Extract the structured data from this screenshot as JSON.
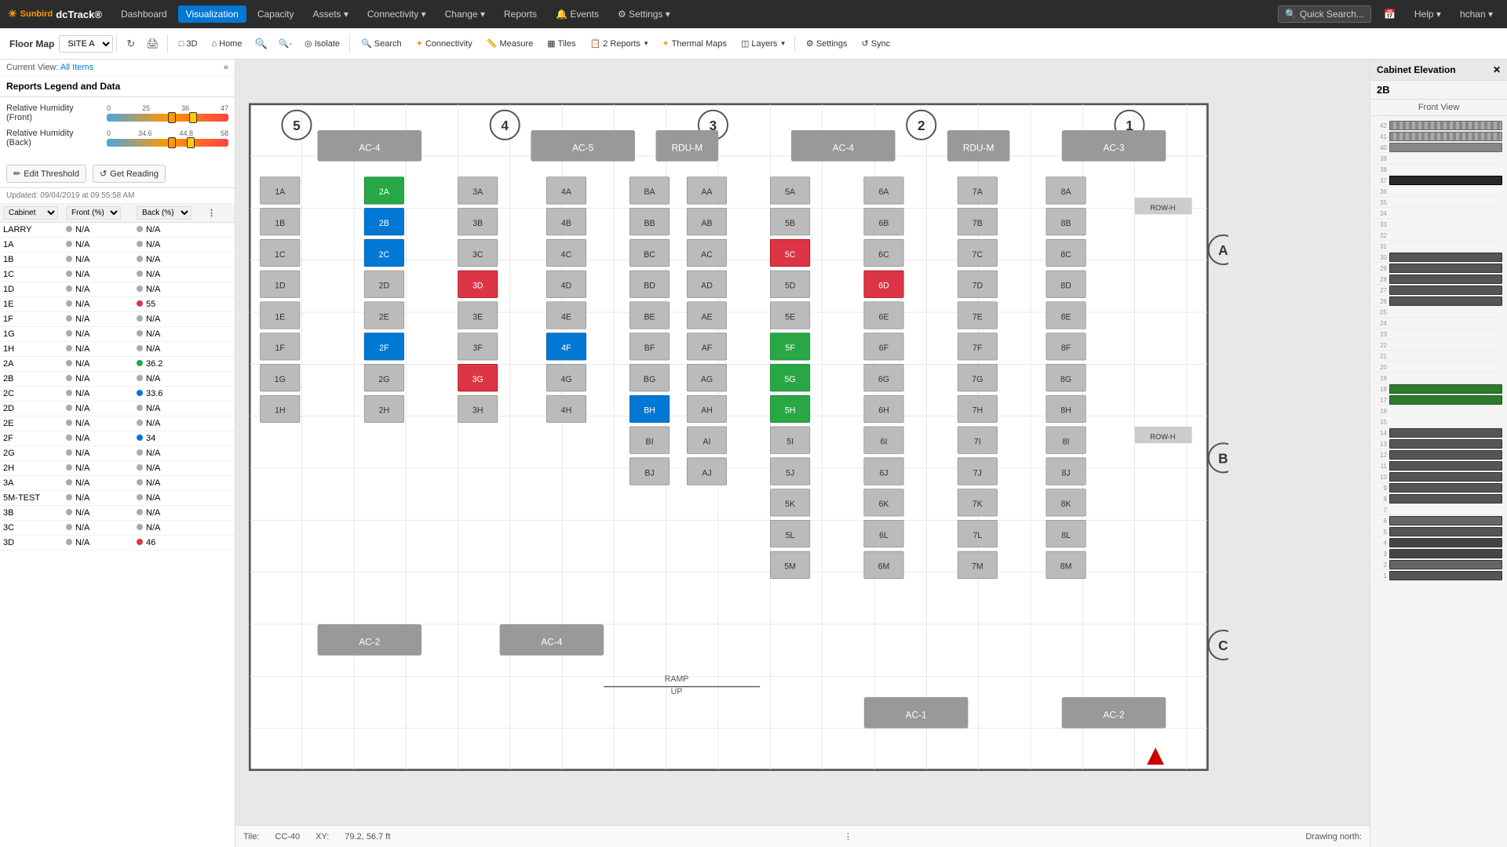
{
  "app": {
    "logo_sun": "☀",
    "logo_text": "dcTrack®",
    "logo_brand": "Sunbird"
  },
  "nav": {
    "items": [
      {
        "label": "Dashboard",
        "active": false
      },
      {
        "label": "Visualization",
        "active": true
      },
      {
        "label": "Capacity",
        "active": false
      },
      {
        "label": "Assets ▾",
        "active": false
      },
      {
        "label": "Connectivity ▾",
        "active": false
      },
      {
        "label": "Change ▾",
        "active": false
      },
      {
        "label": "Reports",
        "active": false
      },
      {
        "label": "🔔 Events",
        "active": false
      },
      {
        "label": "⚙ Settings ▾",
        "active": false
      }
    ],
    "quick_search_placeholder": "Quick Search...",
    "help_label": "Help ▾",
    "user_label": "hchan ▾"
  },
  "toolbar": {
    "floor_map_label": "Floor Map",
    "site_value": "SITE A",
    "buttons": [
      {
        "id": "refresh",
        "icon": "↻",
        "label": ""
      },
      {
        "id": "print",
        "icon": "🖨",
        "label": ""
      },
      {
        "id": "3d",
        "icon": "□",
        "label": "3D"
      },
      {
        "id": "home",
        "icon": "⌂",
        "label": "Home"
      },
      {
        "id": "zoom-in",
        "icon": "🔍+",
        "label": ""
      },
      {
        "id": "zoom-out",
        "icon": "🔍-",
        "label": ""
      },
      {
        "id": "isolate",
        "icon": "◎",
        "label": "Isolate"
      },
      {
        "id": "search",
        "icon": "🔍",
        "label": "Search"
      },
      {
        "id": "connectivity",
        "icon": "✦",
        "label": "Connectivity"
      },
      {
        "id": "measure",
        "icon": "📏",
        "label": "Measure"
      },
      {
        "id": "tiles",
        "icon": "▦",
        "label": "Tiles"
      },
      {
        "id": "reports",
        "icon": "📋",
        "label": "2 Reports ▾"
      },
      {
        "id": "thermal",
        "icon": "✦",
        "label": "Thermal Maps"
      },
      {
        "id": "layers",
        "icon": "◫",
        "label": "Layers ▾"
      },
      {
        "id": "settings",
        "icon": "⚙",
        "label": "Settings"
      },
      {
        "id": "sync",
        "icon": "↺",
        "label": "Sync"
      }
    ]
  },
  "left_panel": {
    "current_view_label": "Current View:",
    "current_view_link": "All Items",
    "collapse_icon": "«",
    "legend_header": "Reports Legend and Data",
    "legend_rows": [
      {
        "label": "Relative Humidity (Front)",
        "min": "0",
        "mid1": "25",
        "mid2": "36",
        "max": "47",
        "marker1_pct": 55,
        "marker2_pct": 72
      },
      {
        "label": "Relative Humidity (Back)",
        "min": "0",
        "mid1": "34.6",
        "mid2": "44.8",
        "max": "58",
        "marker1_pct": 55,
        "marker2_pct": 70
      }
    ],
    "edit_threshold_label": "Edit Threshold",
    "get_reading_label": "Get Reading",
    "updated_label": "Updated: 09/04/2019 at 09:55:58 AM",
    "table_cols": [
      "Cabinet",
      "Front (%)",
      "Back (%)"
    ],
    "table_rows": [
      {
        "cabinet": "LARRY",
        "front": "N/A",
        "front_dot": "na",
        "back": "N/A",
        "back_dot": "na"
      },
      {
        "cabinet": "1A",
        "front": "N/A",
        "front_dot": "na",
        "back": "N/A",
        "back_dot": "na"
      },
      {
        "cabinet": "1B",
        "front": "N/A",
        "front_dot": "na",
        "back": "N/A",
        "back_dot": "na"
      },
      {
        "cabinet": "1C",
        "front": "N/A",
        "front_dot": "na",
        "back": "N/A",
        "back_dot": "na"
      },
      {
        "cabinet": "1D",
        "front": "N/A",
        "front_dot": "na",
        "back": "N/A",
        "back_dot": "na"
      },
      {
        "cabinet": "1E",
        "front": "N/A",
        "front_dot": "na",
        "back": "55",
        "back_dot": "red"
      },
      {
        "cabinet": "1F",
        "front": "N/A",
        "front_dot": "na",
        "back": "N/A",
        "back_dot": "na"
      },
      {
        "cabinet": "1G",
        "front": "N/A",
        "front_dot": "na",
        "back": "N/A",
        "back_dot": "na"
      },
      {
        "cabinet": "1H",
        "front": "N/A",
        "front_dot": "na",
        "back": "N/A",
        "back_dot": "na"
      },
      {
        "cabinet": "2A",
        "front": "N/A",
        "front_dot": "na",
        "back": "36.2",
        "back_dot": "green"
      },
      {
        "cabinet": "2B",
        "front": "N/A",
        "front_dot": "na",
        "back": "N/A",
        "back_dot": "na"
      },
      {
        "cabinet": "2C",
        "front": "N/A",
        "front_dot": "na",
        "back": "33.6",
        "back_dot": "blue"
      },
      {
        "cabinet": "2D",
        "front": "N/A",
        "front_dot": "na",
        "back": "N/A",
        "back_dot": "na"
      },
      {
        "cabinet": "2E",
        "front": "N/A",
        "front_dot": "na",
        "back": "N/A",
        "back_dot": "na"
      },
      {
        "cabinet": "2F",
        "front": "N/A",
        "front_dot": "na",
        "back": "34",
        "back_dot": "blue"
      },
      {
        "cabinet": "2G",
        "front": "N/A",
        "front_dot": "na",
        "back": "N/A",
        "back_dot": "na"
      },
      {
        "cabinet": "2H",
        "front": "N/A",
        "front_dot": "na",
        "back": "N/A",
        "back_dot": "na"
      },
      {
        "cabinet": "3A",
        "front": "N/A",
        "front_dot": "na",
        "back": "N/A",
        "back_dot": "na"
      },
      {
        "cabinet": "5M-TEST",
        "front": "N/A",
        "front_dot": "na",
        "back": "N/A",
        "back_dot": "na"
      },
      {
        "cabinet": "3B",
        "front": "N/A",
        "front_dot": "na",
        "back": "N/A",
        "back_dot": "na"
      },
      {
        "cabinet": "3C",
        "front": "N/A",
        "front_dot": "na",
        "back": "N/A",
        "back_dot": "na"
      },
      {
        "cabinet": "3D",
        "front": "N/A",
        "front_dot": "na",
        "back": "46",
        "back_dot": "red"
      }
    ]
  },
  "cabinet_elevation": {
    "title": "Cabinet Elevation",
    "close_icon": "✕",
    "cabinet_name": "2B",
    "view_label": "Front View",
    "rack_units": 42,
    "devices": [
      {
        "u": 42,
        "u_end": 41,
        "type": "stripe"
      },
      {
        "u": 40,
        "u_end": 40,
        "type": "gray"
      },
      {
        "u": 39,
        "u_end": 38,
        "type": "empty"
      },
      {
        "u": 37,
        "u_end": 37,
        "type": "dark"
      },
      {
        "u": 36,
        "u_end": 33,
        "type": "empty"
      },
      {
        "u": 30,
        "u_end": 26,
        "type": "device"
      },
      {
        "u": 18,
        "u_end": 17,
        "type": "green"
      },
      {
        "u": 14,
        "u_end": 8,
        "type": "device"
      },
      {
        "u": 6,
        "u_end": 1,
        "type": "device"
      }
    ]
  },
  "status_bar": {
    "tile_label": "Tile:",
    "tile_value": "CC-40",
    "xy_label": "XY:",
    "xy_value": "79.2, 56.7 ft",
    "north_label": "Drawing north:"
  },
  "floor_labels": {
    "columns": [
      "5",
      "4",
      "3",
      "2",
      "1"
    ],
    "rows": [
      "A",
      "B",
      "C"
    ]
  }
}
